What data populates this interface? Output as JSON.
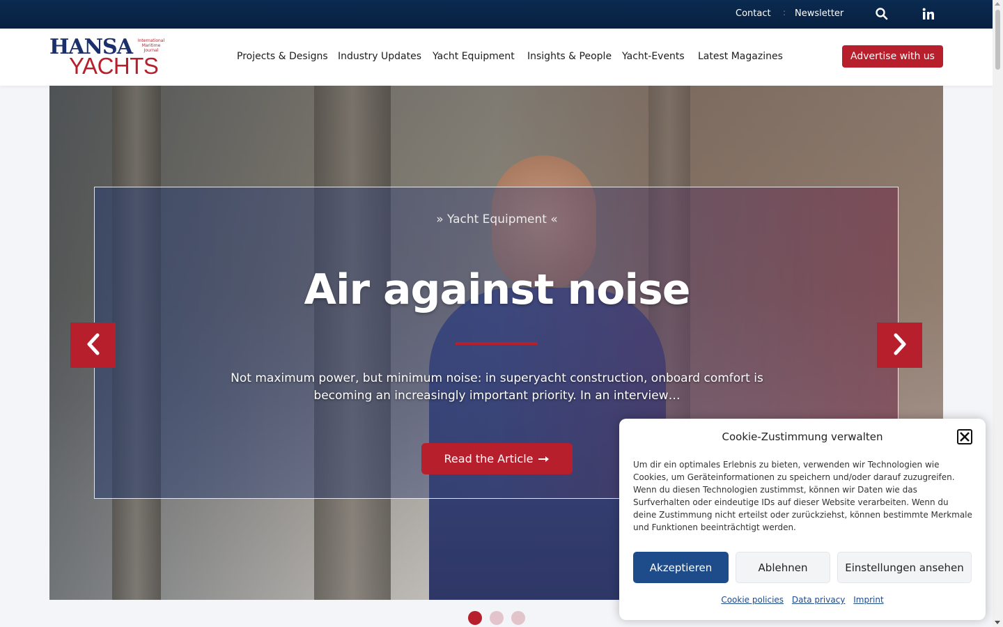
{
  "topbar": {
    "contact": "Contact",
    "separator": ":",
    "newsletter": "Newsletter",
    "search_icon": "search-icon",
    "social_icon": "linkedin-icon"
  },
  "logo": {
    "line1": "HANSA",
    "line2": "YACHTS",
    "tagline": "International Maritime Journal"
  },
  "nav": {
    "items": [
      {
        "label": "Projects & Designs"
      },
      {
        "label": "Industry Updates"
      },
      {
        "label": "Yacht Equipment"
      },
      {
        "label": "Insights & People"
      },
      {
        "label": "Yacht-Events"
      },
      {
        "label": "Latest Magazines"
      }
    ],
    "cta": "Advertise with us"
  },
  "hero": {
    "kicker": "» Yacht Equipment «",
    "headline": "Air against noise",
    "lead": "Not maximum power, but minimum noise: in superyacht construction, onboard comfort is becoming an increasingly important priority. In an interview…",
    "button": "Read the Article",
    "button_icon": "arrow-right-icon",
    "prev_icon": "chevron-left-icon",
    "next_icon": "chevron-right-icon",
    "slides_total": 3,
    "active_slide": 1
  },
  "cookie": {
    "title": "Cookie-Zustimmung verwalten",
    "body": "Um dir ein optimales Erlebnis zu bieten, verwenden wir Technologien wie Cookies, um Geräteinformationen zu speichern und/oder darauf zuzugreifen. Wenn du diesen Technologien zustimmst, können wir Daten wie das Surfverhalten oder eindeutige IDs auf dieser Website verarbeiten. Wenn du deine Zustimmung nicht erteilst oder zurückziehst, können bestimmte Merkmale und Funktionen beeinträchtigt werden.",
    "accept": "Akzeptieren",
    "deny": "Ablehnen",
    "settings": "Einstellungen ansehen",
    "links": [
      "Cookie policies",
      "Data privacy",
      "Imprint"
    ]
  },
  "colors": {
    "brand_red": "#b81f2d",
    "brand_navy": "#0a2a50",
    "cookie_accept": "#1e4b8a"
  }
}
